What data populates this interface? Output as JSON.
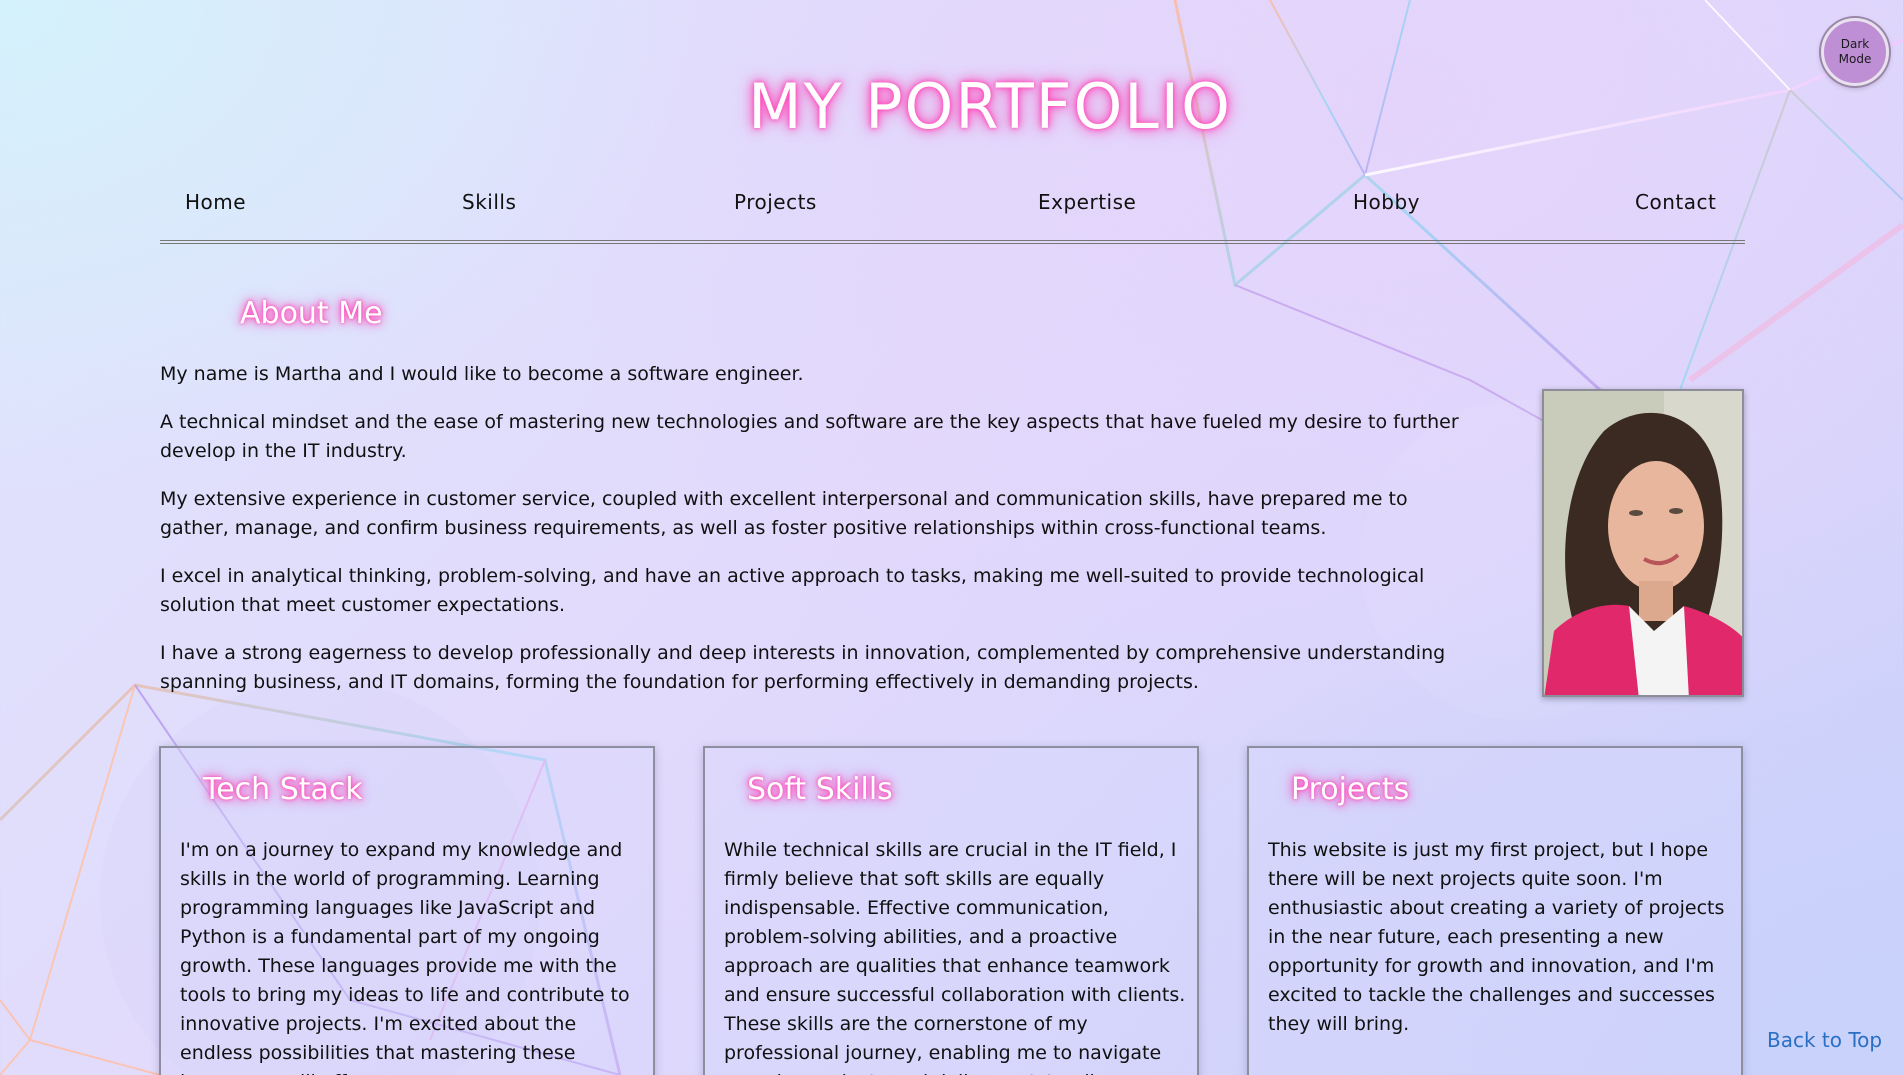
{
  "theme_toggle": {
    "label": "Dark\nMode"
  },
  "header": {
    "title": "MY PORTFOLIO"
  },
  "nav": {
    "items": [
      "Home",
      "Skills",
      "Projects",
      "Expertise",
      "Hobby",
      "Contact"
    ]
  },
  "about": {
    "heading": "About Me",
    "paragraphs": [
      "My name is Martha and I would like to become a software engineer.",
      "A technical mindset and the ease of mastering new technologies and software are the key aspects that have fueled my desire to further develop in the IT industry.",
      "My extensive experience in customer service, coupled with excellent interpersonal and communication skills, have prepared me to gather, manage, and confirm business requirements, as well as foster positive relationships within cross-functional teams.",
      "I excel in analytical thinking, problem-solving, and have an active approach to tasks, making me well-suited to provide technological solution that meet customer expectations.",
      "I have a strong eagerness to develop professionally and deep interests in innovation, complemented by comprehensive understanding spanning business, and IT domains, forming the foundation for performing effectively in demanding projects."
    ]
  },
  "cards": [
    {
      "heading": "Tech Stack",
      "text": "I'm on a journey to expand my knowledge and skills in the world of programming. Learning programming languages like JavaScript and Python is a fundamental part of my ongoing growth. These languages provide me with the tools to bring my ideas to life and contribute to innovative projects. I'm excited about the endless possibilities that mastering these languages will offer."
    },
    {
      "heading": "Soft Skills",
      "text": "While technical skills are crucial in the IT field, I firmly believe that soft skills are equally indispensable. Effective communication, problem-solving abilities, and a proactive approach are qualities that enhance teamwork and ensure successful collaboration with clients. These skills are the cornerstone of my professional journey, enabling me to navigate complex projects and deliver outstanding results."
    },
    {
      "heading": "Projects",
      "text": "This website is just my first project, but I hope there will be next projects quite soon. I'm enthusiastic about creating a variety of projects in the near future, each presenting a new opportunity for growth and innovation, and I'm excited to tackle the challenges and successes they will bring."
    }
  ],
  "footer": {
    "back_to_top": "Back to Top"
  },
  "colors": {
    "glow": "#ff3fb5",
    "link": "#2a6fc4",
    "toggle": "#bf8fd6"
  }
}
